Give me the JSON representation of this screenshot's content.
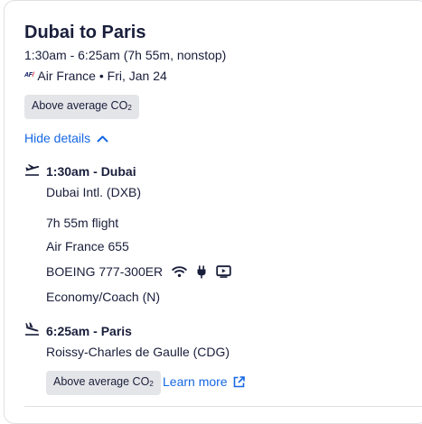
{
  "route": {
    "title": "Dubai to Paris",
    "times_summary": "1:30am - 6:25am (7h 55m, nonstop)",
    "airline_logo_text": "AF",
    "airline_date": "Air France • Fri, Jan 24",
    "co2_badge_text": "Above average CO",
    "co2_badge_sub": "2"
  },
  "details_toggle": {
    "label": "Hide details",
    "icon": "chevron-up-icon"
  },
  "departure": {
    "icon": "takeoff-icon",
    "time_city": "1:30am - Dubai",
    "airport": "Dubai Intl. (DXB)"
  },
  "flight": {
    "duration": "7h 55m flight",
    "number": "Air France 655",
    "aircraft": "BOEING 777-300ER",
    "amenities": [
      "wifi-icon",
      "power-outlet-icon",
      "entertainment-screen-icon"
    ],
    "cabin": "Economy/Coach (N)"
  },
  "arrival": {
    "icon": "landing-icon",
    "time_city": "6:25am - Paris",
    "airport": "Roissy-Charles de Gaulle (CDG)",
    "co2_badge_text": "Above average CO",
    "co2_badge_sub": "2",
    "learn_more": "Learn more",
    "learn_more_icon": "external-link-icon"
  },
  "colors": {
    "text": "#191e3b",
    "link": "#1668e3",
    "badge_bg": "#e4e5e8",
    "border": "#dfe0e4"
  }
}
